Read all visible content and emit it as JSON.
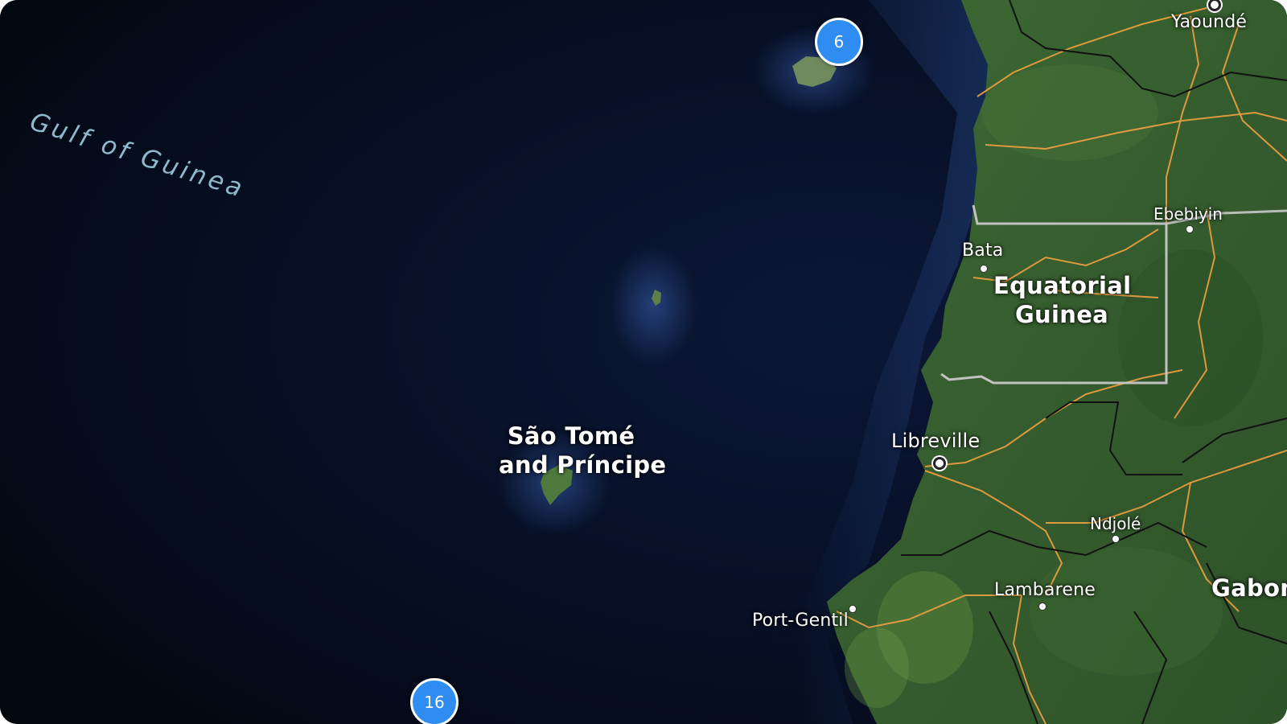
{
  "map": {
    "water_label": "Gulf of Guinea",
    "countries": {
      "sao_tome": [
        "São Tomé",
        "and Príncipe"
      ],
      "equatorial_guinea": [
        "Equatorial",
        "Guinea"
      ],
      "gabon": "Gabon"
    },
    "cities": {
      "yaounde": "Yaoundé",
      "ebebiyin": "Ebebiyin",
      "bata": "Bata",
      "libreville": "Libreville",
      "ndjole": "Ndjolé",
      "lambarene": "Lambarene",
      "port_gentil": "Port-Gentil"
    },
    "clusters": {
      "north": "6",
      "south": "16"
    },
    "colors": {
      "ocean": "#050c1a",
      "land": "#3c6233",
      "roads": "#f0a040",
      "borders": "#111111",
      "cluster": "#2f8cf0"
    }
  }
}
